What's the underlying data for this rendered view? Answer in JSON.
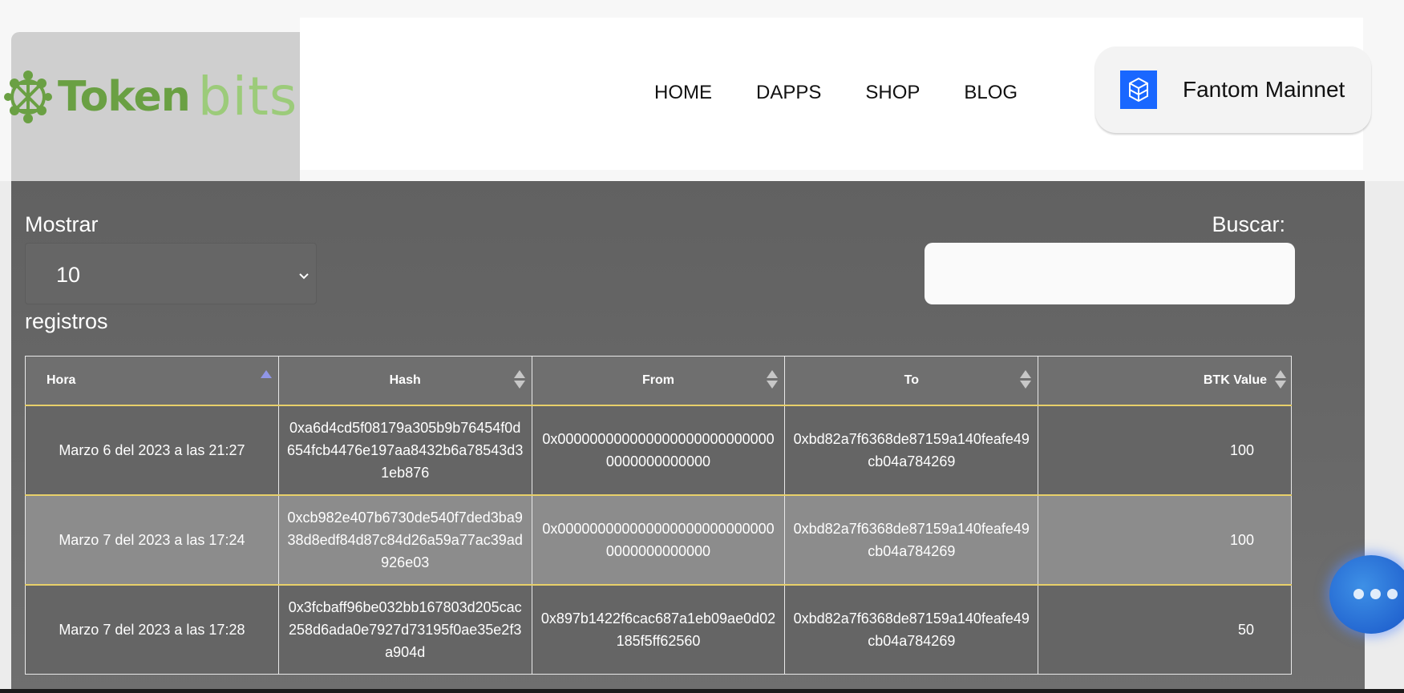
{
  "logo": {
    "token": "Token",
    "bits": "bits"
  },
  "nav": [
    "HOME",
    "DAPPS",
    "SHOP",
    "BLOG"
  ],
  "network": {
    "label": "Fantom Mainnet",
    "icon": "fantom-icon",
    "icon_color": "#1967ff"
  },
  "controls": {
    "show_label": "Mostrar",
    "page_size": "10",
    "records_label": "registros",
    "search_label": "Buscar:",
    "search_value": ""
  },
  "table": {
    "columns": [
      "Hora",
      "Hash",
      "From",
      "To",
      "BTK Value"
    ],
    "sorted_column": "Hora",
    "rows": [
      {
        "hora": "Marzo 6 del 2023 a las 21:27",
        "hash": "0xa6d4cd5f08179a305b9b76454f0d654fcb4476e197aa8432b6a78543d31eb876",
        "from": "0x0000000000000000000000000000000000000000",
        "to": "0xbd82a7f6368de87159a140feafe49cb04a784269",
        "value": "100"
      },
      {
        "hora": "Marzo 7 del 2023 a las 17:24",
        "hash": "0xcb982e407b6730de540f7ded3ba938d8edf84d87c84d26a59a77ac39ad926e03",
        "from": "0x0000000000000000000000000000000000000000",
        "to": "0xbd82a7f6368de87159a140feafe49cb04a784269",
        "value": "100"
      },
      {
        "hora": "Marzo 7 del 2023 a las 17:28",
        "hash": "0x3fcbaff96be032bb167803d205cac258d6ada0e7927d73195f0ae35e2f3a904d",
        "from": "0x897b1422f6cac687a1eb09ae0d02185f5ff62560",
        "to": "0xbd82a7f6368de87159a140feafe49cb04a784269",
        "value": "50"
      }
    ]
  },
  "colors": {
    "accent": "#6aa043",
    "row_border": "#e8d06a",
    "panel": "#666666"
  }
}
